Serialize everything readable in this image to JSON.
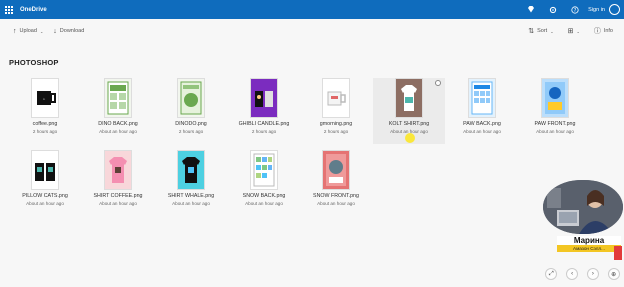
{
  "header": {
    "app_title": "OneDrive",
    "sign_in_label": "Sign in",
    "bg_color": "#0f6cbd"
  },
  "toolbar": {
    "upload_label": "Upload",
    "download_label": "Download",
    "sort_label": "Sort",
    "info_label": "Info"
  },
  "folder": {
    "title": "PHOTOSHOP"
  },
  "files": [
    {
      "name": "coffee.png",
      "date": "2 hours ago",
      "thumb": "mug-black"
    },
    {
      "name": "DINO BACK.png",
      "date": "About an hour ago",
      "thumb": "green-print"
    },
    {
      "name": "DINODO.png",
      "date": "2 hours ago",
      "thumb": "green-print-2"
    },
    {
      "name": "GHIBLI CANDLE.png",
      "date": "2 hours ago",
      "thumb": "purple-candle"
    },
    {
      "name": "gmorning.png",
      "date": "2 hours ago",
      "thumb": "white-mug"
    },
    {
      "name": "KOLT SHIRT.png",
      "date": "About an hour ago",
      "thumb": "shirt-photo"
    },
    {
      "name": "PAW BACK.png",
      "date": "About an hour ago",
      "thumb": "blue-grid"
    },
    {
      "name": "PAW FRONT.png",
      "date": "About an hour ago",
      "thumb": "paw-poster"
    },
    {
      "name": "PILLOW CATS.png",
      "date": "About an hour ago",
      "thumb": "pillows"
    },
    {
      "name": "SHIRT COFFEE.png",
      "date": "About an hour ago",
      "thumb": "pink-shirt"
    },
    {
      "name": "SHIRT WHALE.png",
      "date": "About an hour ago",
      "thumb": "cyan-shirt"
    },
    {
      "name": "SNOW BACK.png",
      "date": "About an hour ago",
      "thumb": "snow-grid"
    },
    {
      "name": "SNOW FRONT.png",
      "date": "About an hour ago",
      "thumb": "snow-poster"
    }
  ],
  "webcam": {
    "name": "Марина",
    "subtitle": "Амазон Сэлл..."
  }
}
